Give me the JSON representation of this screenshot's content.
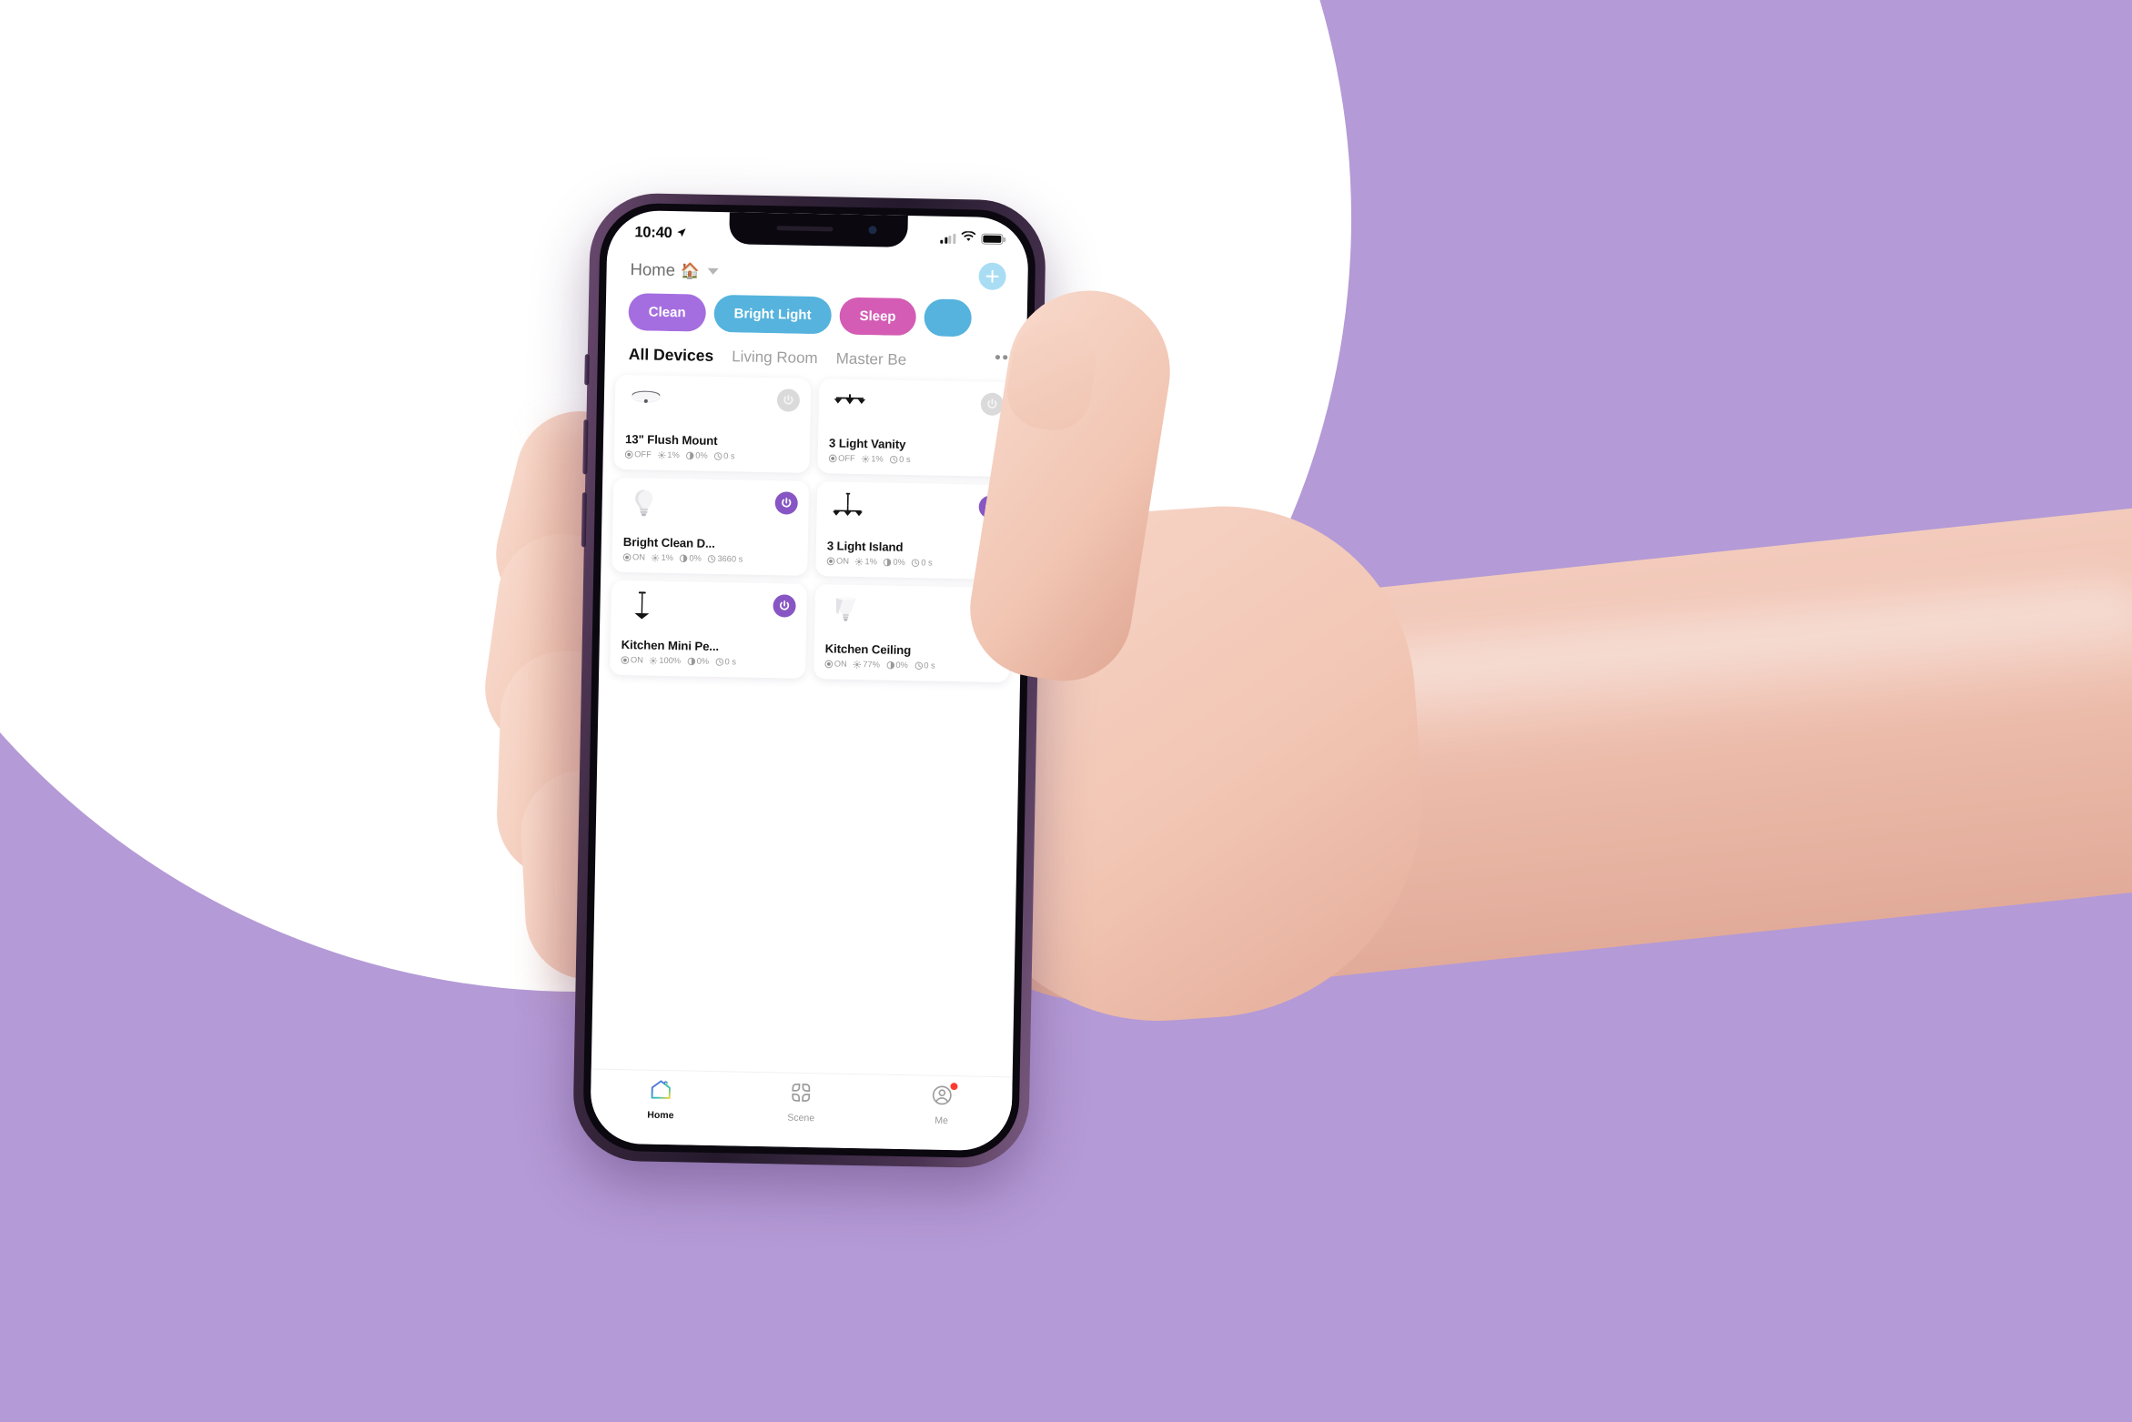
{
  "background": {
    "purple": "#b49ad6",
    "circle_color": "#ffffff"
  },
  "device": {
    "frame_color": "#3b2840",
    "screen_bg": "#ffffff"
  },
  "status_bar": {
    "time": "10:40",
    "location_icon": "location-arrow-icon",
    "signal_icon": "cellular-signal-icon",
    "signal_bars_filled": 2,
    "signal_bars_total": 4,
    "wifi_icon": "wifi-icon",
    "battery_icon": "battery-icon",
    "battery_level": 100
  },
  "header": {
    "home_label": "Home",
    "home_emoji": "🏠",
    "dropdown_icon": "chevron-down-icon",
    "add_label": "+",
    "add_icon": "plus-icon",
    "add_color": "#a9ddf4"
  },
  "scenes": [
    {
      "label": "Clean",
      "color": "#a56ee0"
    },
    {
      "label": "Bright Light",
      "color": "#55b3dd"
    },
    {
      "label": "Sleep",
      "color": "#d45cb4"
    },
    {
      "label": "",
      "color": "#55b3dd"
    }
  ],
  "tabs": [
    {
      "label": "All Devices",
      "active": true
    },
    {
      "label": "Living Room",
      "active": false
    },
    {
      "label": "Master Be",
      "active": false
    }
  ],
  "tabs_more": "•••",
  "devices": [
    {
      "name": "13\" Flush Mount",
      "icon": "flush-mount-ceiling-light-icon",
      "power": "off",
      "state_label": "OFF",
      "brightness": "1%",
      "color_temp": "0%",
      "timer": "0 s",
      "has_color_temp": true
    },
    {
      "name": "3 Light Vanity",
      "icon": "three-light-vanity-icon",
      "power": "off",
      "state_label": "OFF",
      "brightness": "1%",
      "color_temp": null,
      "timer": "0 s",
      "has_color_temp": false
    },
    {
      "name": "Bright Clean D...",
      "icon": "light-bulb-icon",
      "power": "on",
      "state_label": "ON",
      "brightness": "1%",
      "color_temp": "0%",
      "timer": "3660 s",
      "has_color_temp": true
    },
    {
      "name": "3 Light Island",
      "icon": "three-light-island-pendant-icon",
      "power": "on",
      "state_label": "ON",
      "brightness": "1%",
      "color_temp": "0%",
      "timer": "0 s",
      "has_color_temp": true
    },
    {
      "name": "Kitchen Mini Pe...",
      "icon": "mini-pendant-light-icon",
      "power": "on",
      "state_label": "ON",
      "brightness": "100%",
      "color_temp": "0%",
      "timer": "0 s",
      "has_color_temp": true
    },
    {
      "name": "Kitchen Ceiling",
      "icon": "br-flood-bulb-icon",
      "power": "on",
      "state_label": "ON",
      "brightness": "77%",
      "color_temp": "0%",
      "timer": "0 s",
      "has_color_temp": true
    }
  ],
  "bottom_nav": [
    {
      "label": "Home",
      "icon": "home-house-icon",
      "active": true,
      "badge": false
    },
    {
      "label": "Scene",
      "icon": "scene-grid-icon",
      "active": false,
      "badge": false
    },
    {
      "label": "Me",
      "icon": "user-profile-icon",
      "active": false,
      "badge": true
    }
  ],
  "colors": {
    "power_on": "#8756c4",
    "power_off": "#dadada",
    "badge": "#ff3b30",
    "text_primary": "#141414",
    "text_muted": "#9b9b9b"
  }
}
